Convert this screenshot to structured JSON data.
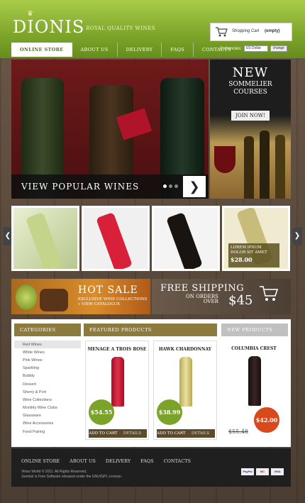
{
  "header": {
    "logo": "DIONIS",
    "tagline": "ROYAL QUALITY WINES",
    "cart": {
      "label": "Shopping Cart",
      "status": "(empty)"
    },
    "currency": {
      "label": "Currencies:",
      "selected": "US Dollar",
      "button": "change"
    }
  },
  "nav": {
    "items": [
      {
        "label": "ONLINE STORE"
      },
      {
        "label": "ABOUT US"
      },
      {
        "label": "DELIVERY"
      },
      {
        "label": "FAQS"
      },
      {
        "label": "CONTACTS"
      }
    ]
  },
  "hero": {
    "caption": "VIEW POPULAR WINES",
    "next": "❯"
  },
  "promo": {
    "title": "NEW",
    "subtitle_1": "SOMMELIER",
    "subtitle_2": "COURSES",
    "button": "JOIN NOW!"
  },
  "carousel": {
    "prev": "❮",
    "next": "❯",
    "overlay_text": "LOREM IPSUM DOLOR SIT AMET",
    "overlay_price": "$28.00"
  },
  "banners": {
    "hot": {
      "title": "HOT SALE",
      "line1": "EXCLUSIVE WINE COLLECTIONS",
      "line2": "» VIEW CATALOGUE"
    },
    "ship": {
      "title": "FREE SHIPPING",
      "line1": "ON ORDERS",
      "line2": "OVER",
      "amount": "$45"
    }
  },
  "categories": {
    "heading": "CATEGORIES",
    "items": [
      "Red Wines",
      "White Wines",
      "Pink Wines",
      "Sparkling",
      "Bubbly",
      "Dessert",
      "Sherry & Port",
      "Wine Collections",
      "Monthly Wine Clubs",
      "Glassware",
      "Wine Accessories",
      "Food Pairing"
    ]
  },
  "featured": {
    "heading": "FEATURED PRODUCTS",
    "products": [
      {
        "name": "MENAGE A TROIS ROSE",
        "price": "$54.55",
        "add": "ADD TO CART",
        "details": "DETAILS"
      },
      {
        "name": "HAWK CHARDONNAY",
        "price": "$38.99",
        "add": "ADD TO CART",
        "details": "DETAILS"
      }
    ]
  },
  "new_products": {
    "heading": "NEW PRODUCTS",
    "product": {
      "name": "COLUMBIA CREST",
      "old_price": "$55.48",
      "price": "$42.00"
    }
  },
  "footer": {
    "nav": [
      "ONLINE STORE",
      "ABOUT US",
      "DELIVERY",
      "FAQS",
      "CONTACTS"
    ],
    "copy_line1": "Virtuo World © 2011. All Rights Reserved.",
    "copy_line2": "Joomla! is Free Software released under the GNU/GPL License.",
    "payments": [
      "PayPal",
      "MC",
      "VISA"
    ]
  },
  "colors": {
    "header_green": "#7ea52a",
    "section_gold": "#8c7b3c",
    "price_green": "#7ba32a",
    "price_red": "#d8491c",
    "footer_dark": "#1f1f1f"
  }
}
